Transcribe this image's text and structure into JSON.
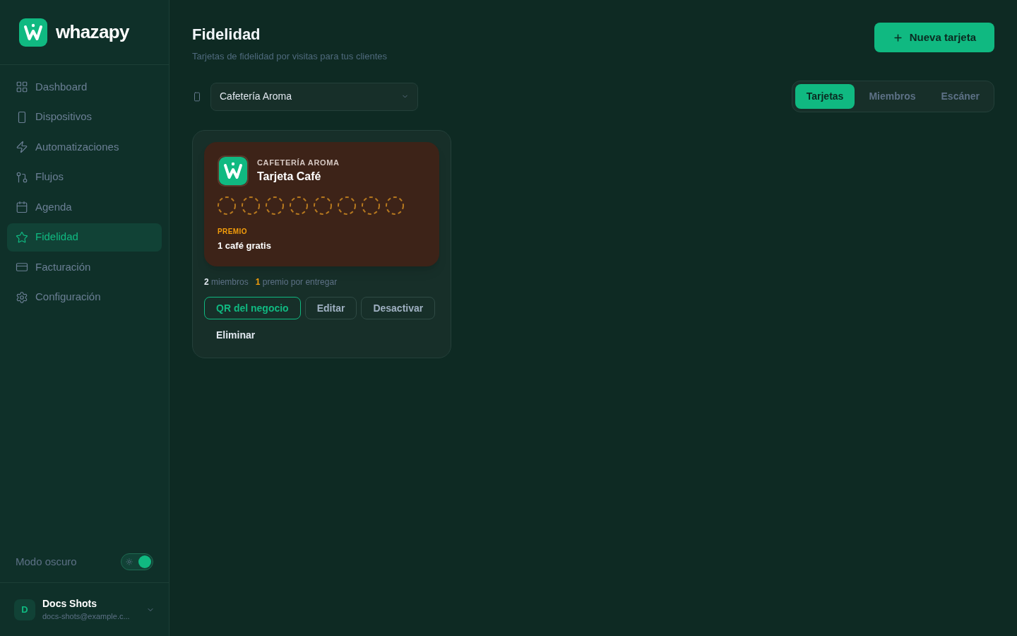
{
  "brand": {
    "name": "whazapy"
  },
  "sidebar": {
    "items": [
      {
        "label": "Dashboard",
        "selected": false
      },
      {
        "label": "Dispositivos",
        "selected": false
      },
      {
        "label": "Automatizaciones",
        "selected": false
      },
      {
        "label": "Flujos",
        "selected": false
      },
      {
        "label": "Agenda",
        "selected": false
      },
      {
        "label": "Fidelidad",
        "selected": true
      },
      {
        "label": "Facturación",
        "selected": false
      },
      {
        "label": "Configuración",
        "selected": false
      }
    ]
  },
  "dark_mode": {
    "label": "Modo oscuro",
    "on": true
  },
  "user": {
    "initial": "D",
    "name": "Docs Shots",
    "email": "docs-shots@example.c..."
  },
  "header": {
    "title": "Fidelidad",
    "subtitle": "Tarjetas de fidelidad por visitas para tus clientes",
    "action": "Nueva tarjeta"
  },
  "business_select": {
    "value": "Cafetería Aroma"
  },
  "tabs": [
    {
      "label": "Tarjetas",
      "selected": true
    },
    {
      "label": "Miembros",
      "selected": false
    },
    {
      "label": "Escáner",
      "selected": false
    }
  ],
  "cards": [
    {
      "business": "CAFETERÍA AROMA",
      "title": "Tarjeta Café",
      "stamps": [
        {
          "filled": false
        },
        {
          "filled": false
        },
        {
          "filled": false
        },
        {
          "filled": false
        },
        {
          "filled": false
        },
        {
          "filled": false
        },
        {
          "filled": false
        },
        {
          "filled": false
        }
      ],
      "reward_label": "PREMIO",
      "reward": "1 café gratis",
      "stats": [
        {
          "kind": "members",
          "count": "2",
          "label": "miembros"
        },
        {
          "kind": "pending",
          "count": "1",
          "label": "premio por entregar"
        }
      ],
      "actions": [
        {
          "label": "QR del negocio",
          "kind": "primary"
        },
        {
          "label": "Editar",
          "kind": "outline"
        },
        {
          "label": "Desactivar",
          "kind": "outline"
        },
        {
          "label": "Eliminar",
          "kind": "ghost"
        }
      ]
    }
  ]
}
